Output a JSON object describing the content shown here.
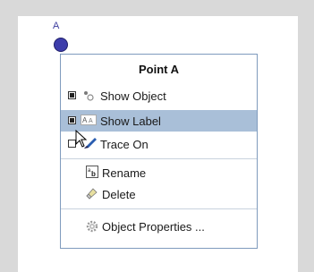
{
  "point": {
    "label": "A"
  },
  "context_menu": {
    "title": "Point A",
    "items": [
      {
        "label": "Show Object",
        "checked": true,
        "icon": "show-object-icon"
      },
      {
        "label": "Show Label",
        "checked": true,
        "icon": "show-label-icon",
        "highlighted": true
      },
      {
        "label": "Trace On",
        "checked": false,
        "icon": "trace-pen-icon"
      },
      {
        "label": "Rename",
        "icon": "rename-icon"
      },
      {
        "label": "Delete",
        "icon": "eraser-icon"
      },
      {
        "label": "Object Properties ...",
        "icon": "gear-icon"
      }
    ]
  },
  "colors": {
    "highlight": "#a9bfd8",
    "point": "#3d3dab",
    "menu_border": "#7f9bbd"
  }
}
